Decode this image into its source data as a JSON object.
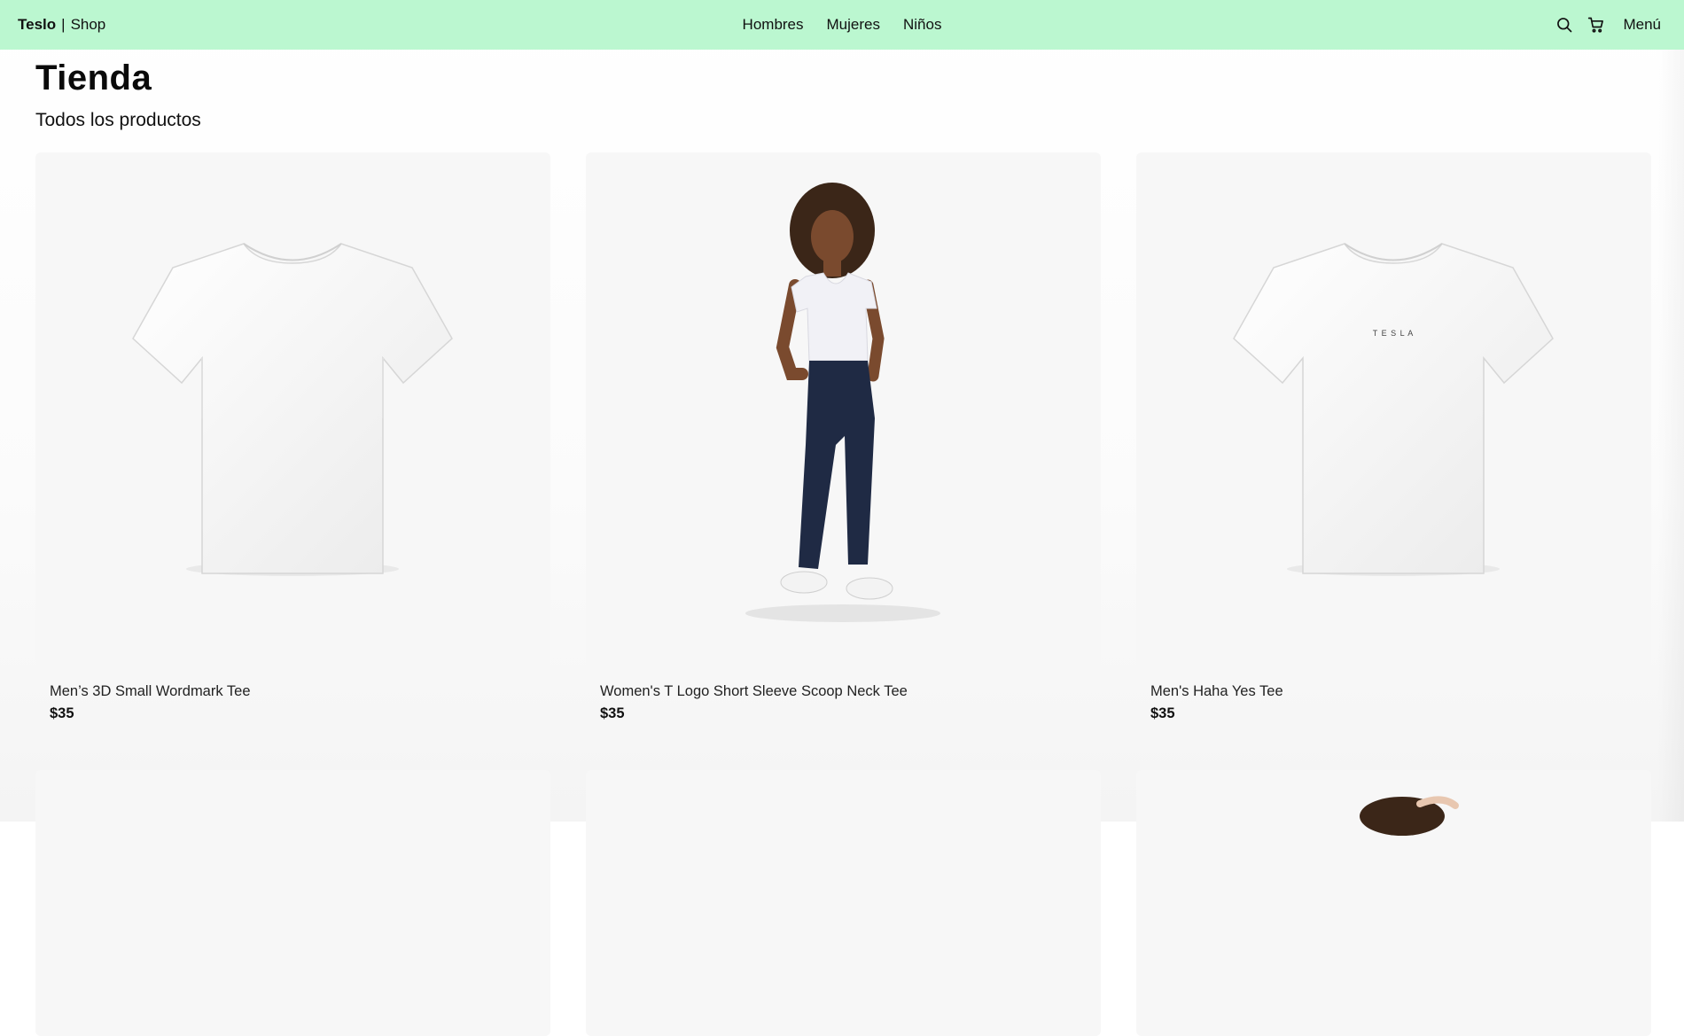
{
  "header": {
    "brand_name": "Teslo",
    "brand_sep": "|",
    "brand_suffix": "Shop",
    "nav": [
      "Hombres",
      "Mujeres",
      "Niños"
    ],
    "menu_label": "Menú",
    "icons": {
      "search": "search-icon",
      "cart": "cart-icon"
    },
    "accent_color": "#bbf7d0"
  },
  "page": {
    "title": "Tienda",
    "subtitle": "Todos los productos"
  },
  "products": [
    {
      "title": "Men’s 3D Small Wordmark Tee",
      "price": "$35",
      "image": "white-tshirt"
    },
    {
      "title": "Women's T Logo Short Sleeve Scoop Neck Tee",
      "price": "$35",
      "image": "woman-white-tee-jeans"
    },
    {
      "title": "Men's Haha Yes Tee",
      "price": "$35",
      "image": "white-tshirt-tesla-logo"
    },
    {
      "image": "product-image"
    },
    {
      "image": "product-image"
    },
    {
      "image": "model-photo"
    }
  ],
  "tshirt_logo_text": "T E S L A"
}
